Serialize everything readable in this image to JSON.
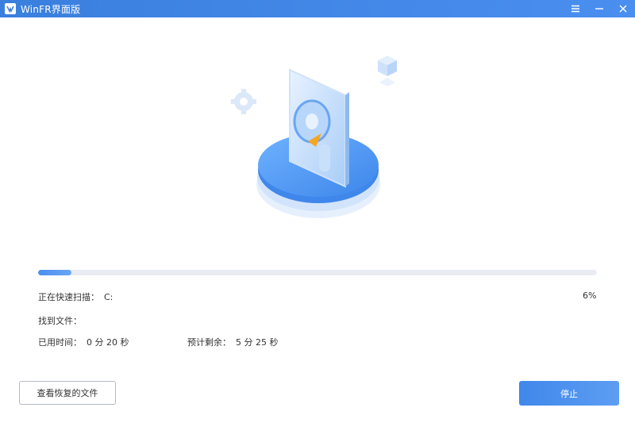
{
  "window": {
    "title": "WinFR界面版",
    "logo_icon": "app-logo-icon",
    "controls": [
      "menu-icon",
      "minimize-icon",
      "close-icon"
    ]
  },
  "scan": {
    "status_label": "正在快速扫描：",
    "drive": "C:",
    "progress_text": "6%",
    "progress_value": 0.06,
    "files_found_label": "找到文件：",
    "elapsed_label": "已用时间：",
    "elapsed_value": "0 分 20 秒",
    "remaining_label": "预计剩余：",
    "remaining_value": "5 分 25 秒"
  },
  "buttons": {
    "view_recovered": "查看恢复的文件",
    "stop": "停止"
  },
  "colors": {
    "titlebar": "#3a7fdd",
    "accent": "#4a8ff0",
    "track": "#e9ecf3"
  }
}
